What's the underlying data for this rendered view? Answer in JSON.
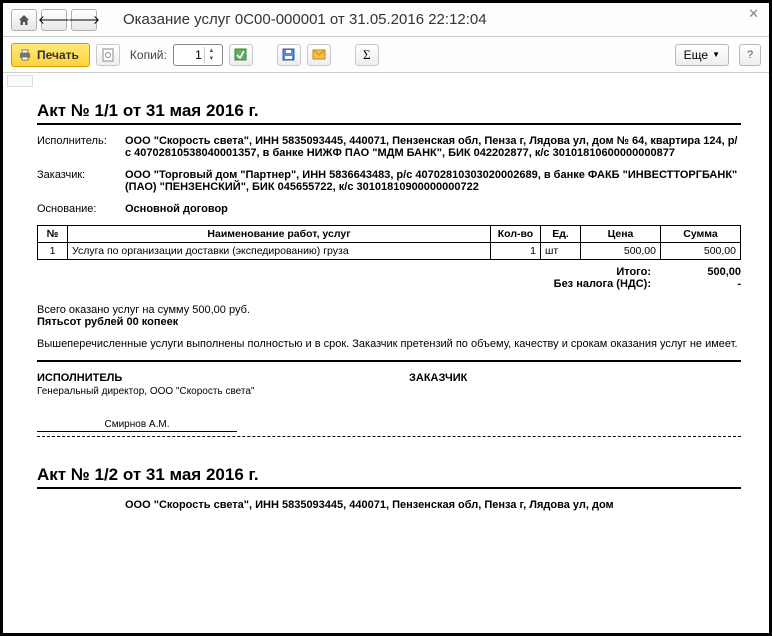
{
  "window": {
    "title": "Оказание услуг 0С00-000001 от 31.05.2016 22:12:04"
  },
  "toolbar": {
    "print_label": "Печать",
    "copies_label": "Копий:",
    "copies_value": "1",
    "more_label": "Еще"
  },
  "acts": [
    {
      "header": "Акт № 1/1 от 31 мая 2016 г.",
      "executor_label": "Исполнитель:",
      "executor_value": "ООО \"Скорость света\", ИНН 5835093445, 440071, Пензенская обл, Пенза г, Лядова ул, дом № 64, квартира 124, р/с 40702810538040001357, в банке НИЖФ ПАО \"МДМ БАНК\", БИК 042202877, к/с 30101810600000000877",
      "customer_label": "Заказчик:",
      "customer_value": "ООО \"Торговый дом \"Партнер\", ИНН 5836643483, р/с 40702810303020002689, в банке ФАКБ \"ИНВЕСТТОРГБАНК\" (ПАО) \"ПЕНЗЕНСКИЙ\", БИК 045655722, к/с 30101810900000000722",
      "basis_label": "Основание:",
      "basis_value": "Основной договор",
      "table": {
        "headers": {
          "num": "№",
          "name": "Наименование работ, услуг",
          "qty": "Кол-во",
          "unit": "Ед.",
          "price": "Цена",
          "sum": "Сумма"
        },
        "rows": [
          {
            "num": "1",
            "name": "Услуга по организации доставки (экспедированию) груза",
            "qty": "1",
            "unit": "шт",
            "price": "500,00",
            "sum": "500,00"
          }
        ]
      },
      "totals": {
        "total_label": "Итого:",
        "total_value": "500,00",
        "vat_label": "Без налога (НДС):",
        "vat_value": "-"
      },
      "sum_words_prefix": "Всего оказано услуг на сумму 500,00 руб.",
      "sum_words": "Пятьсот рублей 00 копеек",
      "note": "Вышеперечисленные услуги выполнены полностью и в срок. Заказчик претензий по объему, качеству и срокам оказания услуг не имеет.",
      "sig_executor": "ИСПОЛНИТЕЛЬ",
      "sig_executor_sub": "Генеральный директор, ООО \"Скорость света\"",
      "sig_executor_name": "Смирнов А.М.",
      "sig_customer": "ЗАКАЗЧИК"
    },
    {
      "header": "Акт № 1/2 от 31 мая 2016 г.",
      "executor_value": "ООО \"Скорость света\", ИНН 5835093445, 440071, Пензенская обл, Пенза г, Лядова ул, дом"
    }
  ]
}
